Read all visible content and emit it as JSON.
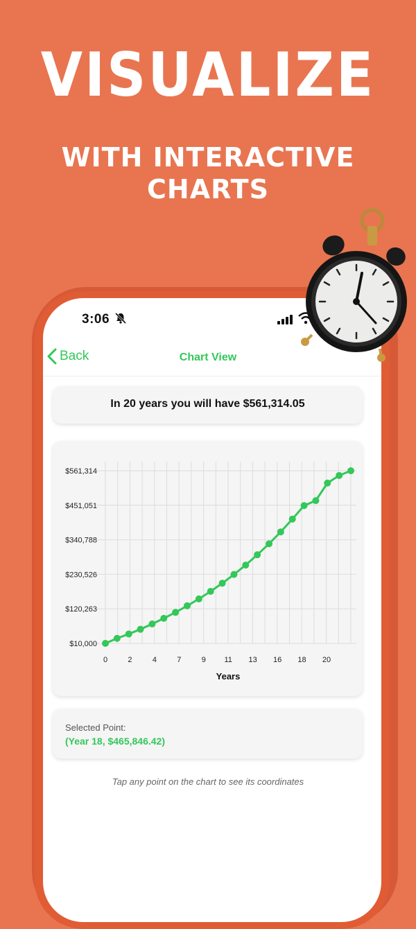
{
  "promo": {
    "headline": "VISUALIZE",
    "subline_1": "WITH INTERACTIVE",
    "subline_2": "CHARTS"
  },
  "status_bar": {
    "time": "3:06"
  },
  "nav": {
    "back_label": "Back",
    "title": "Chart View"
  },
  "summary": {
    "text": "In 20 years you will have $561,314.05"
  },
  "selected": {
    "label": "Selected Point:",
    "value": "(Year 18, $465,846.42)"
  },
  "hint": "Tap any point on the chart to see its coordinates",
  "colors": {
    "accent": "#34c759",
    "background": "#e87550"
  },
  "chart_data": {
    "type": "line",
    "xlabel": "Years",
    "ylabel": "",
    "x_ticks": [
      "0",
      "2",
      "4",
      "7",
      "9",
      "11",
      "13",
      "16",
      "18",
      "20"
    ],
    "y_ticks": [
      "$10,000",
      "$120,263",
      "$230,526",
      "$340,788",
      "$451,051",
      "$561,314"
    ],
    "ylim": [
      10000,
      561314
    ],
    "grid": true,
    "x": [
      0,
      1,
      2,
      3,
      4,
      5,
      6,
      7,
      8,
      9,
      10,
      11,
      12,
      13,
      14,
      15,
      16,
      17,
      18,
      19,
      20,
      21
    ],
    "series": [
      {
        "values": [
          10000,
          26000,
          40000,
          55000,
          72000,
          90000,
          109000,
          130000,
          152000,
          176000,
          202000,
          230000,
          260000,
          293000,
          328000,
          366000,
          407000,
          450000,
          465846.42,
          522000,
          546000,
          561314.05
        ]
      }
    ]
  }
}
